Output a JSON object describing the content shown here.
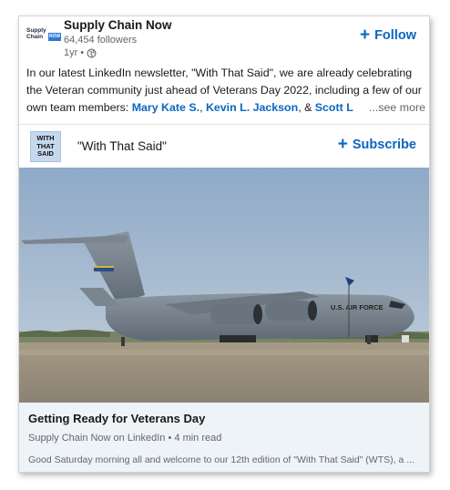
{
  "post": {
    "company_name": "Supply Chain Now",
    "followers": "64,454 followers",
    "age": "1yr",
    "separator": "•",
    "follow_label": "Follow",
    "text_intro": "In our latest LinkedIn newsletter, \"With That Said\", we are already celebrating the Veteran community just ahead of Veterans Day 2022, including a few of our own team members: ",
    "mention_1": "Mary Kate S.",
    "mention_sep": ", ",
    "mention_2": "Kevin L. Jackson",
    "amp": ", & ",
    "mention_3": "Scott L",
    "see_more": "...see more",
    "logo_text_1": "Supply",
    "logo_text_2": "Chain",
    "logo_badge": "NOW"
  },
  "newsletter": {
    "icon_line_1": "WITH",
    "icon_line_2": "THAT",
    "icon_line_3": "SAID",
    "title": "\"With That Said\"",
    "subscribe_label": "Subscribe"
  },
  "image": {
    "fuselage_text": "U.S. AIR FORCE",
    "description_icon": "c17-aircraft-image"
  },
  "article": {
    "title": "Getting Ready for Veterans Day",
    "meta": "Supply Chain Now on LinkedIn • 4 min read",
    "snippet": "Good Saturday morning all and welcome to our 12th edition of \"With That Said\" (WTS), a ..."
  },
  "colors": {
    "accent": "#0a66c2",
    "footer_bg": "#eef3f8"
  }
}
